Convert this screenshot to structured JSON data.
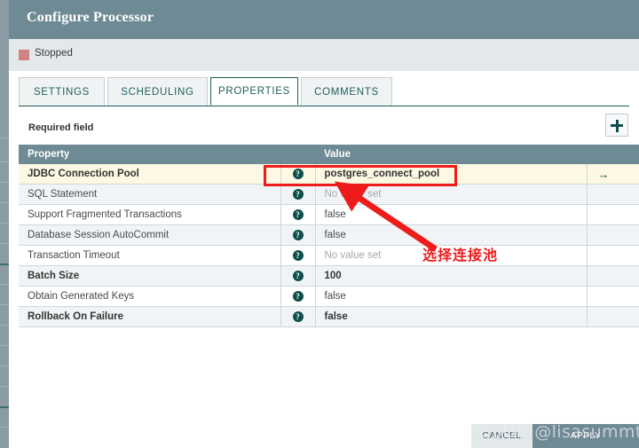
{
  "window": {
    "title": "Configure Processor"
  },
  "status": {
    "label": "Stopped",
    "color": "#d18282"
  },
  "tabs": [
    {
      "label": "SETTINGS",
      "active": false
    },
    {
      "label": "SCHEDULING",
      "active": false
    },
    {
      "label": "PROPERTIES",
      "active": true
    },
    {
      "label": "COMMENTS",
      "active": false
    }
  ],
  "toolbar": {
    "required_note": "Required field",
    "add_icon": "plus-icon"
  },
  "table": {
    "columns": [
      "Property",
      "",
      "Value",
      ""
    ],
    "rows": [
      {
        "name": "JDBC Connection Pool",
        "required": true,
        "help": "?",
        "value": "postgres_connect_pool",
        "unset": false,
        "value_bold": true,
        "go": "→",
        "highlighted": true
      },
      {
        "name": "SQL Statement",
        "required": false,
        "help": "?",
        "value": "No value set",
        "unset": true,
        "value_bold": false,
        "go": "",
        "highlighted": false
      },
      {
        "name": "Support Fragmented Transactions",
        "required": false,
        "help": "?",
        "value": "false",
        "unset": false,
        "value_bold": false,
        "go": "",
        "highlighted": false
      },
      {
        "name": "Database Session AutoCommit",
        "required": false,
        "help": "?",
        "value": "false",
        "unset": false,
        "value_bold": false,
        "go": "",
        "highlighted": false
      },
      {
        "name": "Transaction Timeout",
        "required": false,
        "help": "?",
        "value": "No value set",
        "unset": true,
        "value_bold": false,
        "go": "",
        "highlighted": false
      },
      {
        "name": "Batch Size",
        "required": true,
        "help": "?",
        "value": "100",
        "unset": false,
        "value_bold": true,
        "go": "",
        "highlighted": false
      },
      {
        "name": "Obtain Generated Keys",
        "required": false,
        "help": "?",
        "value": "false",
        "unset": false,
        "value_bold": false,
        "go": "",
        "highlighted": false
      },
      {
        "name": "Rollback On Failure",
        "required": true,
        "help": "?",
        "value": "false",
        "unset": false,
        "value_bold": true,
        "go": "",
        "highlighted": false
      }
    ]
  },
  "annotation": {
    "text": "选择连接池",
    "color": "#ee1b1b"
  },
  "footer": {
    "cancel_label": "CANCEL",
    "apply_label": "APPLY"
  },
  "watermark": {
    "text": "CSDN @lisasummt"
  },
  "colors": {
    "header": "#6e8a94",
    "accent": "#0d4f4a",
    "highlight_row": "#fdf8e3",
    "annotation": "#ee1b1b"
  }
}
